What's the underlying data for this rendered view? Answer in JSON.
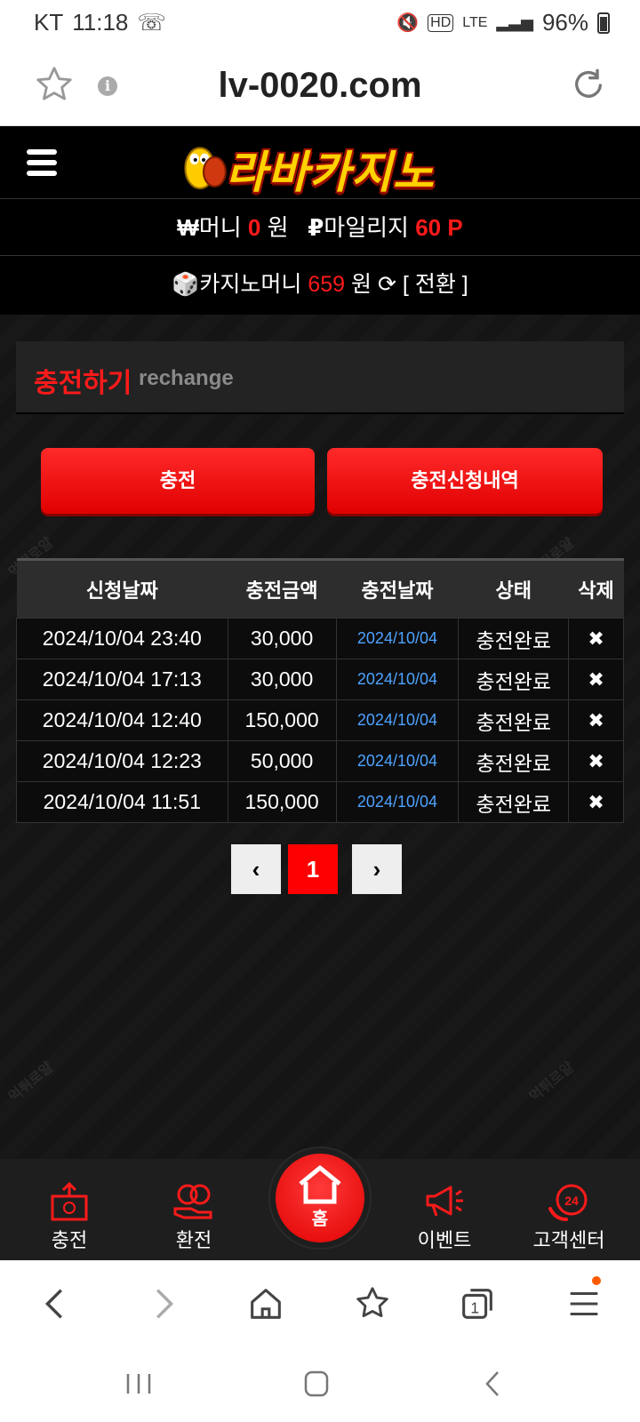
{
  "status_bar": {
    "carrier": "KT",
    "time": "11:18",
    "signal": "LTE",
    "battery": "96%"
  },
  "browser": {
    "url": "lv-0020.com"
  },
  "site": {
    "logo_text": "라바카지노"
  },
  "money": {
    "label": "머니",
    "value": "0",
    "unit": "원",
    "mileage_label": "마일리지",
    "mileage_value": "60 P"
  },
  "casino": {
    "label": "카지노머니",
    "value": "659",
    "unit": "원",
    "convert": "[ 전환 ]"
  },
  "page": {
    "title_ko": "충전하기",
    "title_en": "rechange"
  },
  "buttons": {
    "charge": "충전",
    "history": "충전신청내역"
  },
  "table": {
    "headers": [
      "신청날짜",
      "충전금액",
      "충전날짜",
      "상태",
      "삭제"
    ],
    "rows": [
      {
        "request_date": "2024/10/04 23:40",
        "amount": "30,000",
        "charge_date": "2024/10/04",
        "status": "충전완료",
        "delete": "✖"
      },
      {
        "request_date": "2024/10/04 17:13",
        "amount": "30,000",
        "charge_date": "2024/10/04",
        "status": "충전완료",
        "delete": "✖"
      },
      {
        "request_date": "2024/10/04 12:40",
        "amount": "150,000",
        "charge_date": "2024/10/04",
        "status": "충전완료",
        "delete": "✖"
      },
      {
        "request_date": "2024/10/04 12:23",
        "amount": "50,000",
        "charge_date": "2024/10/04",
        "status": "충전완료",
        "delete": "✖"
      },
      {
        "request_date": "2024/10/04 11:51",
        "amount": "150,000",
        "charge_date": "2024/10/04",
        "status": "충전완료",
        "delete": "✖"
      }
    ]
  },
  "pagination": {
    "prev": "‹",
    "current": "1",
    "next": "›"
  },
  "bottom_nav": {
    "charge": "충전",
    "exchange": "환전",
    "home": "홈",
    "event": "이벤트",
    "support": "고객센터"
  },
  "colors": {
    "accent": "#ff1a1a",
    "link": "#4ea3ff",
    "background": "#111111"
  }
}
